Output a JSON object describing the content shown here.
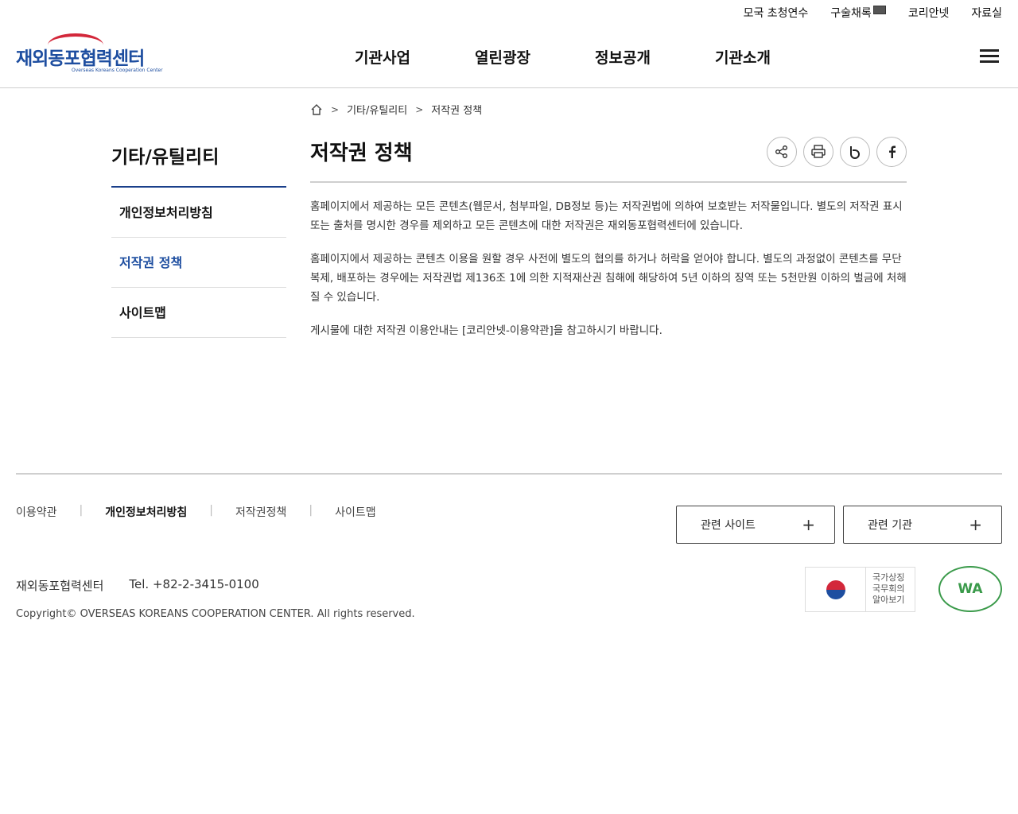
{
  "utility": [
    "모국 초청연수",
    "구술채록",
    "코리안넷",
    "자료실"
  ],
  "logo": {
    "text": "재외동포협력센터",
    "sub": "Overseas Koreans Cooperation Center"
  },
  "gnb": [
    "기관사업",
    "열린광장",
    "정보공개",
    "기관소개"
  ],
  "breadcrumb": {
    "level1": "기타/유틸리티",
    "level2": "저작권 정책"
  },
  "lnb": {
    "title": "기타/유틸리티",
    "items": [
      {
        "label": "개인정보처리방침",
        "active": false
      },
      {
        "label": "저작권 정책",
        "active": true
      },
      {
        "label": "사이트맵",
        "active": false
      }
    ]
  },
  "content": {
    "title": "저작권 정책",
    "paragraphs": [
      "홈페이지에서 제공하는 모든 콘텐츠(웹문서, 첨부파일, DB정보 등)는 저작권법에 의하여 보호받는 저작물입니다. 별도의 저작권 표시 또는 출처를 명시한 경우를 제외하고 모든 콘텐츠에 대한 저작권은 재외동포협력센터에 있습니다.",
      "홈페이지에서 제공하는 콘텐츠 이용을 원할 경우 사전에 별도의 협의를 하거나 허락을 얻어야 합니다. 별도의 과정없이 콘텐츠를 무단 복제, 배포하는 경우에는 저작권법 제136조 1에 의한 지적재산권 침해에 해당하여 5년 이하의 징역 또는 5천만원 이하의 벌금에 처해질 수 있습니다.",
      "게시물에 대한 저작권 이용안내는 [코리안넷-이용약관]을 참고하시기 바랍니다."
    ]
  },
  "footer": {
    "links": [
      "이용약관",
      "개인정보처리방침",
      "저작권정책",
      "사이트맵"
    ],
    "related_sites": "관련 사이트",
    "related_orgs": "관련 기관",
    "org": "재외동포협력센터",
    "tel": "Tel. +82-2-3415-0100",
    "copyright": "Copyright© OVERSEAS KOREANS COOPERATION CENTER. All rights reserved.",
    "gov_text": [
      "국가상징",
      "국무회의",
      "알아보기"
    ],
    "wa_text": "WA"
  }
}
